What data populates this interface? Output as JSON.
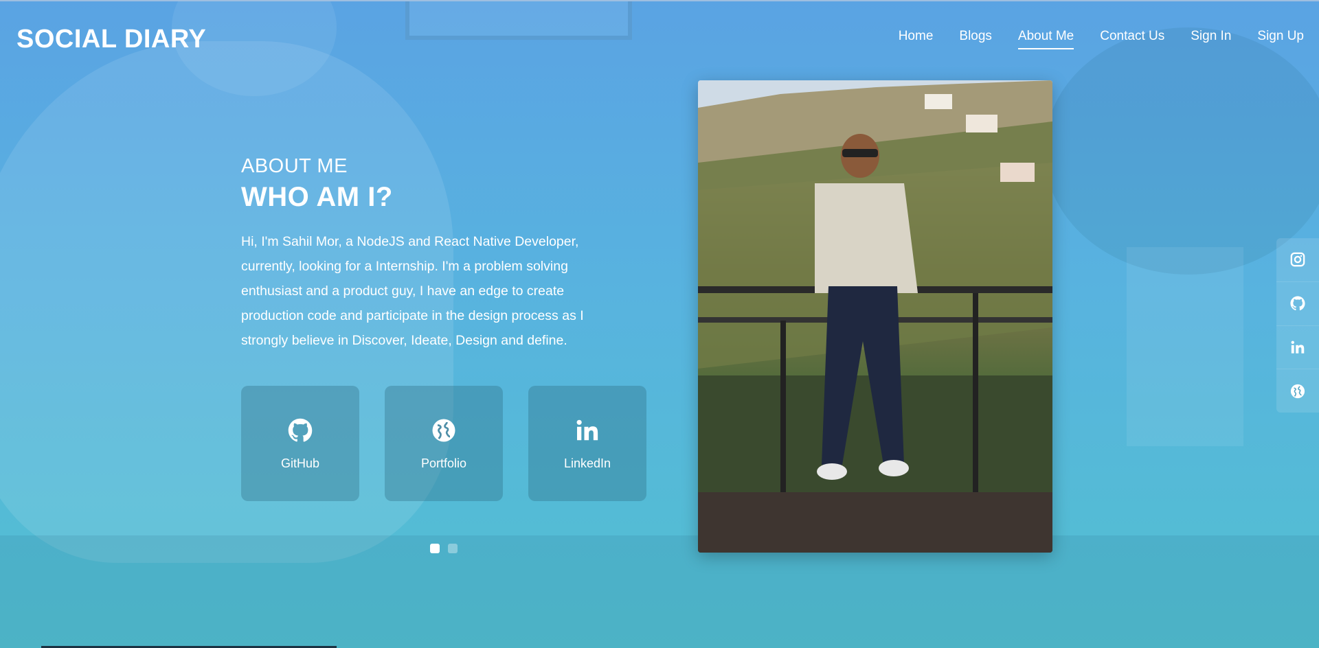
{
  "brand": {
    "name": "SOCIAL DIARY"
  },
  "nav": {
    "items": [
      {
        "label": "Home"
      },
      {
        "label": "Blogs"
      },
      {
        "label": "About Me",
        "active": true
      },
      {
        "label": "Contact Us"
      },
      {
        "label": "Sign In"
      },
      {
        "label": "Sign Up"
      }
    ]
  },
  "about": {
    "eyebrow": "ABOUT ME",
    "headline": "WHO AM I?",
    "bio": "Hi, I'm Sahil Mor, a NodeJS and React Native Developer, currently, looking for a Internship. I'm a problem solving enthusiast and a product guy, I have an edge to create production code and participate in the design process as I strongly believe in Discover, Ideate, Design and define."
  },
  "cards": [
    {
      "label": "GitHub",
      "icon": "github-icon"
    },
    {
      "label": "Portfolio",
      "icon": "globe-icon"
    },
    {
      "label": "LinkedIn",
      "icon": "linkedin-icon"
    }
  ],
  "carousel": {
    "total": 2,
    "active": 1
  },
  "social_rail": [
    {
      "icon": "instagram-icon"
    },
    {
      "icon": "github-icon"
    },
    {
      "icon": "linkedin-icon"
    },
    {
      "icon": "globe-icon"
    }
  ],
  "colors": {
    "accent": "#ffffff",
    "bg_top": "#5aa3e3",
    "bg_bottom": "#52c0d0"
  }
}
